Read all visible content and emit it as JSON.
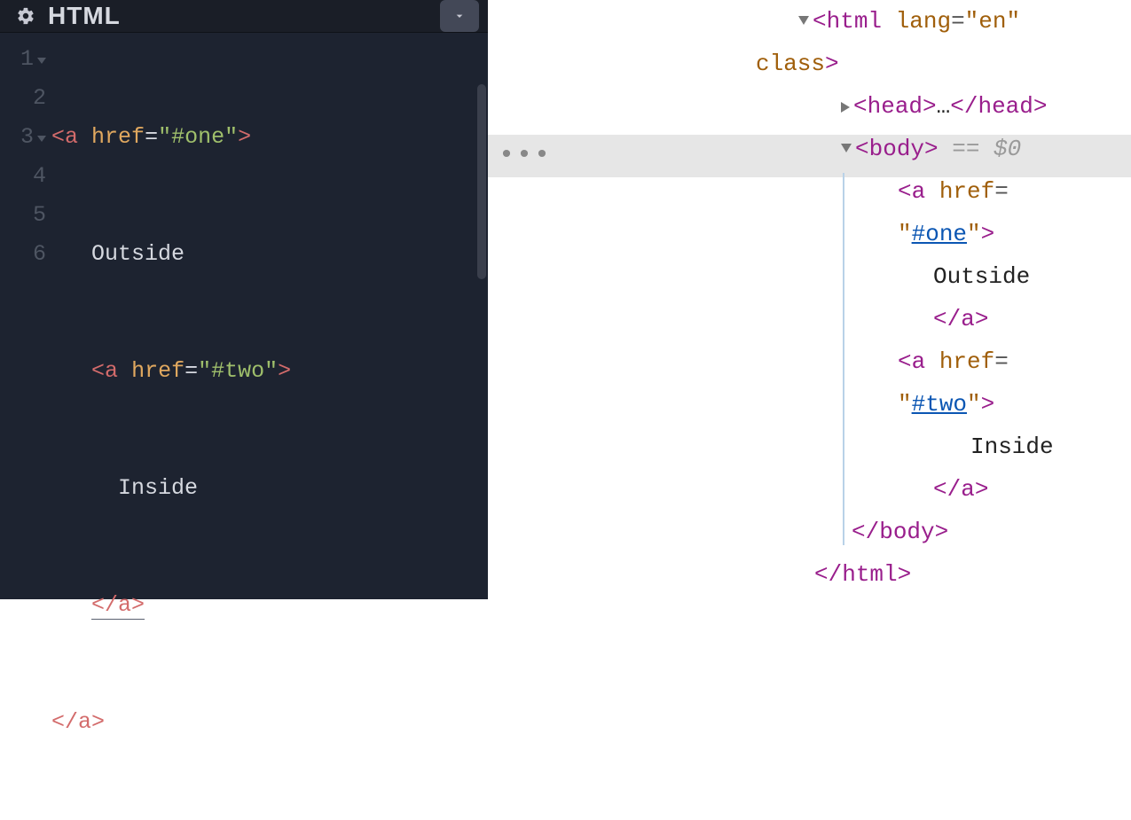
{
  "editor": {
    "title": "HTML",
    "lines": [
      1,
      2,
      3,
      4,
      5,
      6
    ],
    "fold_lines": [
      1,
      3
    ],
    "code": {
      "l1": {
        "open": "<",
        "tag": "a",
        "sp1": " ",
        "attr": "href",
        "eq": "=",
        "q1": "\"",
        "val": "#one",
        "q2": "\"",
        "close": ">"
      },
      "l2": {
        "indent": "   ",
        "text": "Outside"
      },
      "l3": {
        "indent": "   ",
        "open": "<",
        "tag": "a",
        "sp1": " ",
        "attr": "href",
        "eq": "=",
        "q1": "\"",
        "val": "#two",
        "q2": "\"",
        "close": ">"
      },
      "l4": {
        "indent": "     ",
        "text": "Inside"
      },
      "l5": {
        "indent": "   ",
        "open": "</",
        "tag": "a",
        "close": ">"
      },
      "l6": {
        "open": "</",
        "tag": "a",
        "close": ">"
      }
    }
  },
  "devtools": {
    "ellipsis": "•••",
    "highlight_row": 3,
    "l1": {
      "tag": "html",
      "sp": " ",
      "attr": "lang",
      "eq": "=",
      "q1": "\"",
      "val": "en",
      "q2": "\""
    },
    "l2": {
      "attr2": "class",
      "close": ">"
    },
    "l3": {
      "tag": "head",
      "mid": "…"
    },
    "l4": {
      "tag": "body",
      "close": ">",
      "hint": " == $0"
    },
    "l5": {
      "tag": "a",
      "sp": " ",
      "attr": "href",
      "eq": "="
    },
    "l6": {
      "q1": "\"",
      "val": "#one",
      "q2": "\"",
      "close": ">"
    },
    "l7": {
      "text": "Outside"
    },
    "l8": {
      "open": "</",
      "tag": "a",
      "close": ">"
    },
    "l9": {
      "tag": "a",
      "sp": " ",
      "attr": "href",
      "eq": "="
    },
    "l10": {
      "q1": "\"",
      "val": "#two",
      "q2": "\"",
      "close": ">"
    },
    "l11": {
      "text": "Inside"
    },
    "l12": {
      "open": "</",
      "tag": "a",
      "close": ">"
    },
    "l13": {
      "open": "</",
      "tag": "body",
      "close": ">"
    },
    "l14": {
      "open": "</",
      "tag": "html",
      "close": ">"
    }
  }
}
